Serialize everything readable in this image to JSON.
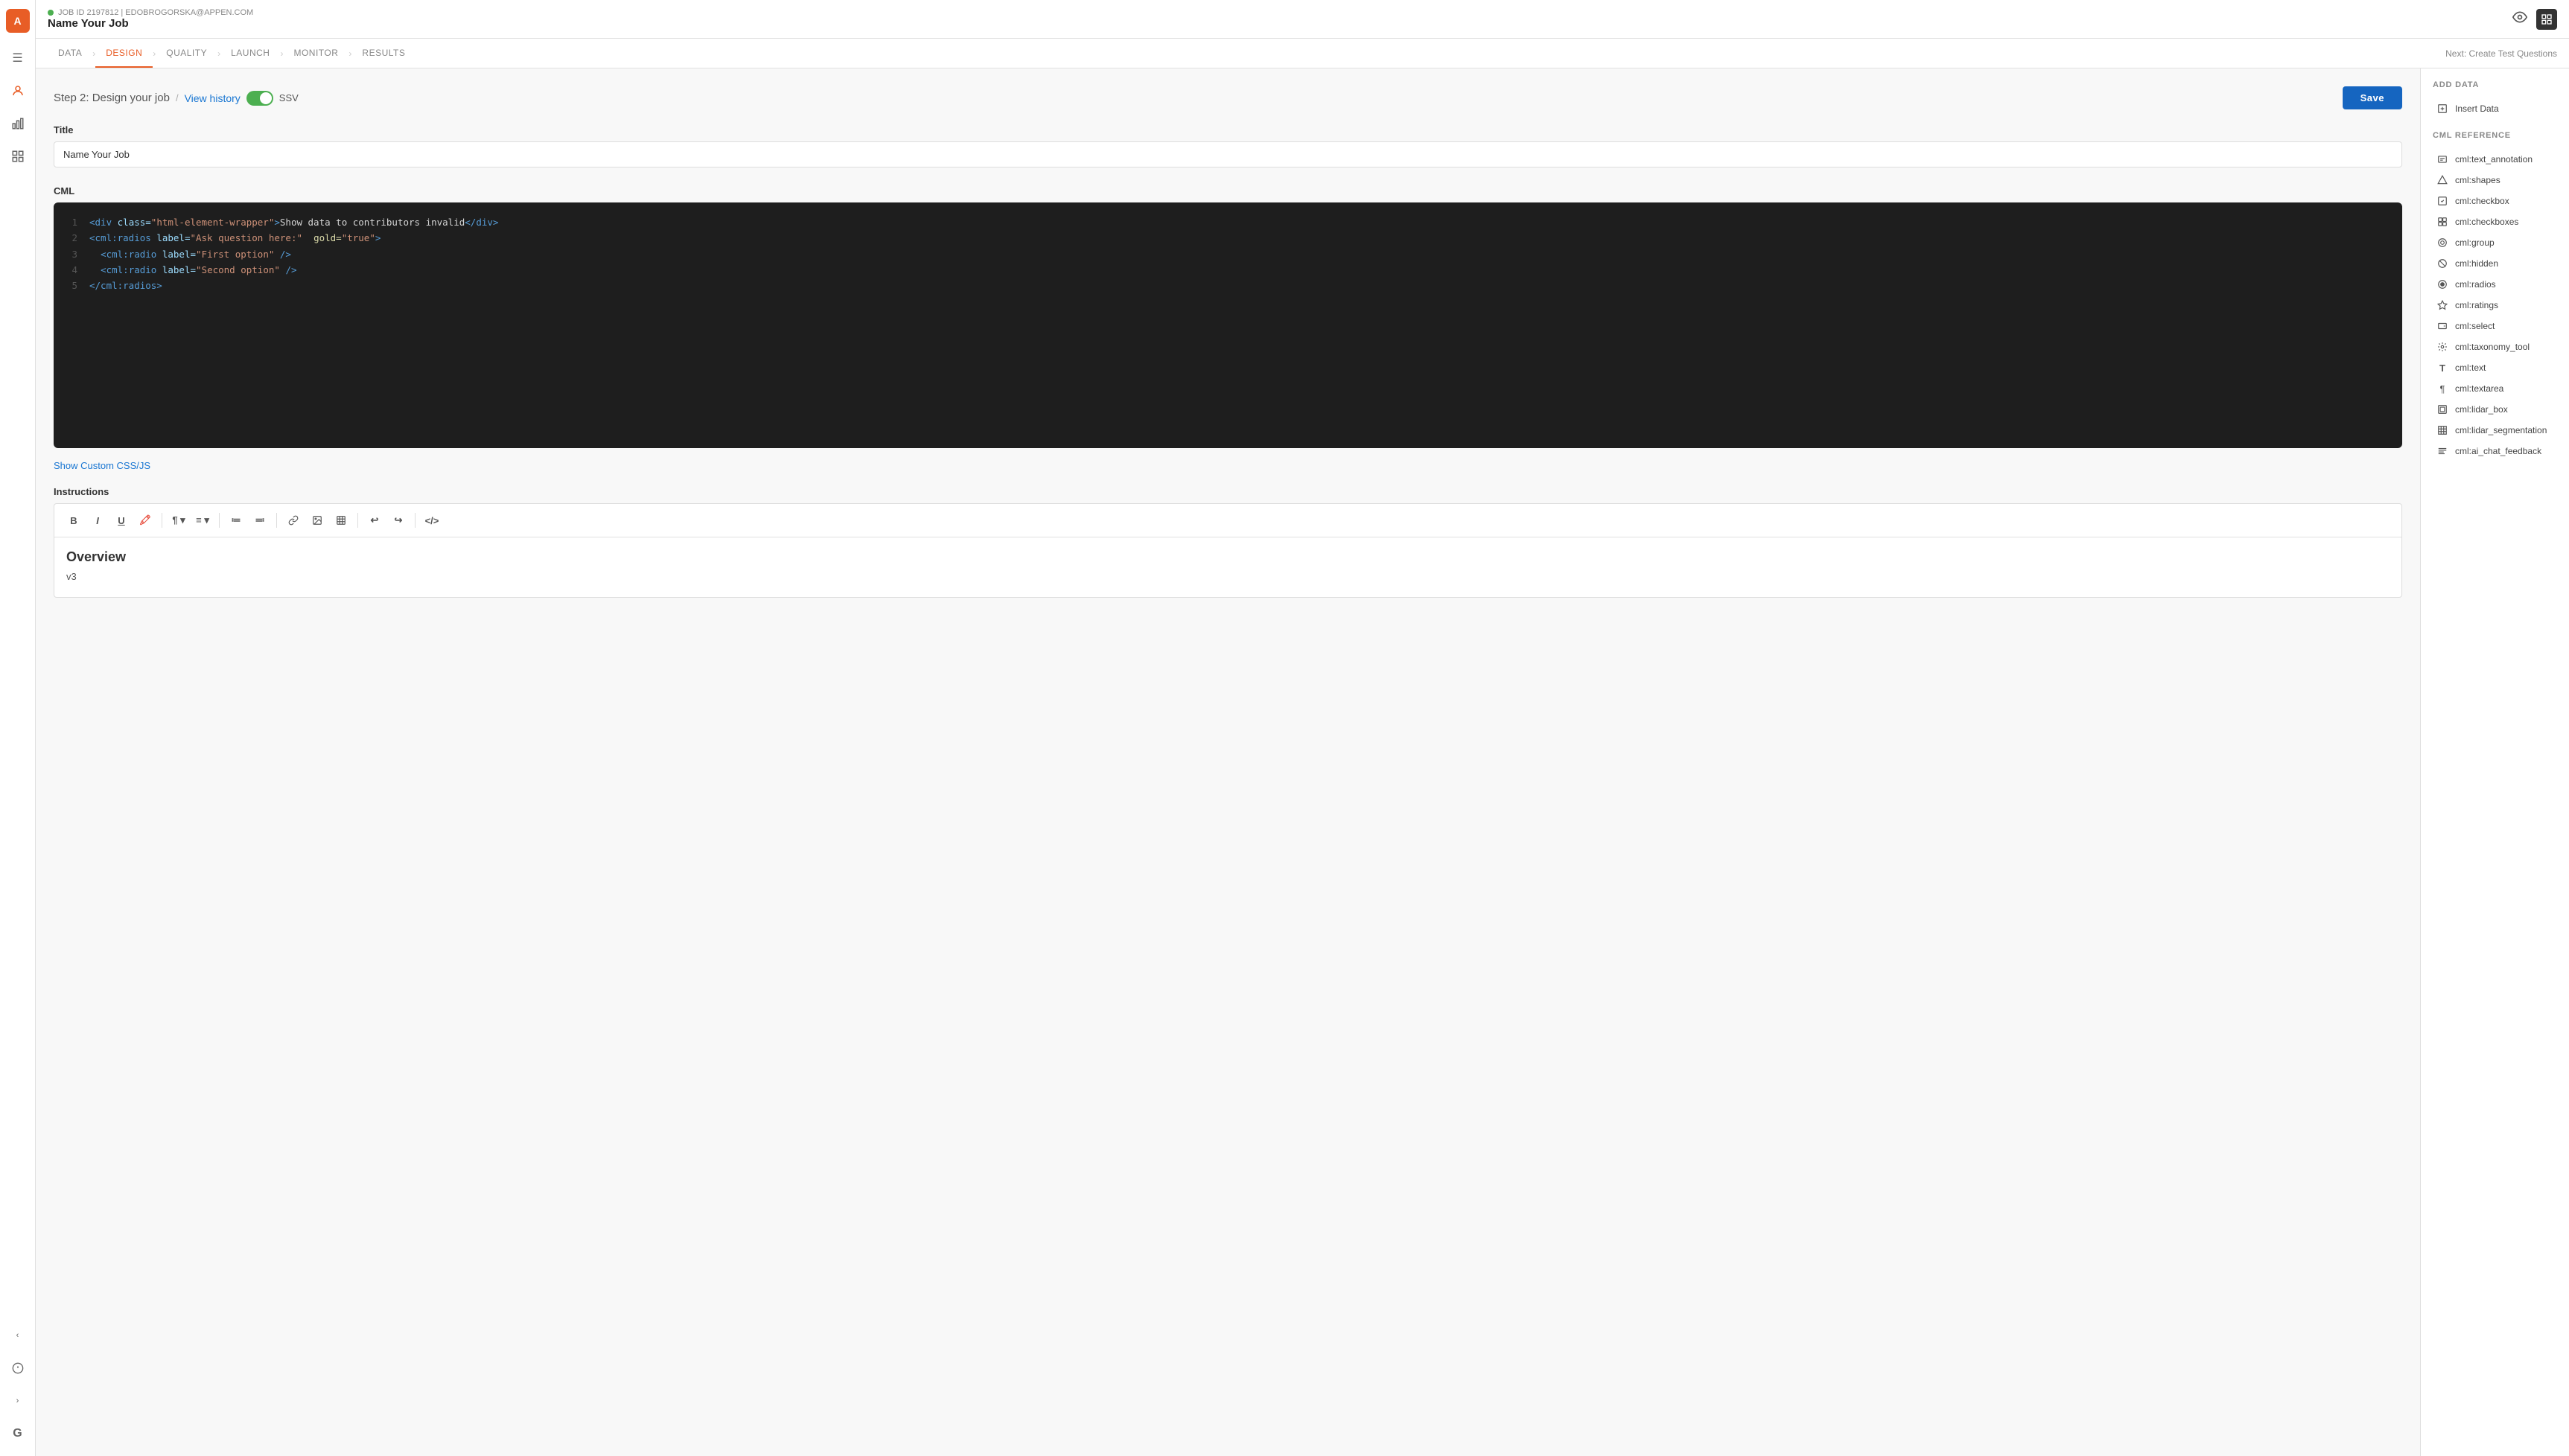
{
  "app": {
    "logo_text": "A",
    "logo_bg": "#e85d26"
  },
  "topbar": {
    "job_meta": "JOB ID 2197812 | EDOBROGORSKA@APPEN.COM",
    "job_title": "Name Your Job",
    "status_color": "#4caf50"
  },
  "nav": {
    "tabs": [
      {
        "id": "data",
        "label": "DATA",
        "active": false
      },
      {
        "id": "design",
        "label": "DESIGN",
        "active": true
      },
      {
        "id": "quality",
        "label": "QUALITY",
        "active": false
      },
      {
        "id": "launch",
        "label": "LAUNCH",
        "active": false
      },
      {
        "id": "monitor",
        "label": "MONITOR",
        "active": false
      },
      {
        "id": "results",
        "label": "RESULTS",
        "active": false
      }
    ],
    "next_label": "Next: Create Test Questions"
  },
  "step": {
    "title": "Step 2: Design your job",
    "divider": "/",
    "view_history": "View history",
    "ssv_label": "SSV",
    "save_label": "Save"
  },
  "title_section": {
    "label": "Title",
    "value": "Name Your Job",
    "placeholder": "Name Your Job"
  },
  "cml_section": {
    "label": "CML",
    "lines": [
      {
        "num": "1",
        "html": "<span class='c-tag'>&lt;div</span> <span class='c-attr'>class=</span><span class='c-string'>\"html-element-wrapper\"</span><span class='c-tag'>&gt;</span><span class='c-text'>Show data to contributors invalid</span><span class='c-tag'>&lt;/div&gt;</span>"
      },
      {
        "num": "2",
        "html": "<span class='c-tag'>&lt;cml:radios</span> <span class='c-attr'>label=</span><span class='c-string'>\"Ask question here:\"</span>  <span class='c-gold'>gold=</span><span class='c-string'>\"true\"</span><span class='c-tag'>&gt;</span>"
      },
      {
        "num": "3",
        "html": "  <span class='c-tag'>&lt;cml:radio</span> <span class='c-attr'>label=</span><span class='c-string'>\"First option\"</span> <span class='c-tag'>/&gt;</span>"
      },
      {
        "num": "4",
        "html": "  <span class='c-tag'>&lt;cml:radio</span> <span class='c-attr'>label=</span><span class='c-string'>\"Second option\"</span> <span class='c-tag'>/&gt;</span>"
      },
      {
        "num": "5",
        "html": "<span class='c-tag'>&lt;/cml:radios&gt;</span>"
      }
    ]
  },
  "custom_css": {
    "label": "Show Custom CSS/JS"
  },
  "instructions": {
    "label": "Instructions",
    "toolbar_buttons": [
      "B",
      "I",
      "U",
      "🖍",
      "¶",
      "≡",
      "≔",
      "≕",
      "🔗",
      "🖼",
      "⊞",
      "↩",
      "↪",
      "</>"
    ],
    "content_heading": "Overview",
    "content_body": "v3"
  },
  "right_panel": {
    "add_data_title": "ADD DATA",
    "add_data_items": [
      {
        "icon": "insert",
        "label": "Insert Data"
      }
    ],
    "cml_ref_title": "CML REFERENCE",
    "cml_ref_items": [
      {
        "icon": "T",
        "label": "cml:text_annotation"
      },
      {
        "icon": "◇",
        "label": "cml:shapes"
      },
      {
        "icon": "☑",
        "label": "cml:checkbox"
      },
      {
        "icon": "⊟",
        "label": "cml:checkboxes"
      },
      {
        "icon": "⊙",
        "label": "cml:group"
      },
      {
        "icon": "⊘",
        "label": "cml:hidden"
      },
      {
        "icon": "◉",
        "label": "cml:radios"
      },
      {
        "icon": "★",
        "label": "cml:ratings"
      },
      {
        "icon": "▭",
        "label": "cml:select"
      },
      {
        "icon": "⊛",
        "label": "cml:taxonomy_tool"
      },
      {
        "icon": "T",
        "label": "cml:text"
      },
      {
        "icon": "¶",
        "label": "cml:textarea"
      },
      {
        "icon": "⊟",
        "label": "cml:lidar_box"
      },
      {
        "icon": "⊞",
        "label": "cml:lidar_segmentation"
      },
      {
        "icon": "≡",
        "label": "cml:ai_chat_feedback"
      }
    ]
  },
  "sidebar_icons": {
    "top": [
      "☰",
      "👤",
      "📊",
      "⊞"
    ],
    "bottom": [
      "‹",
      "ℹ",
      "›",
      "G"
    ]
  }
}
